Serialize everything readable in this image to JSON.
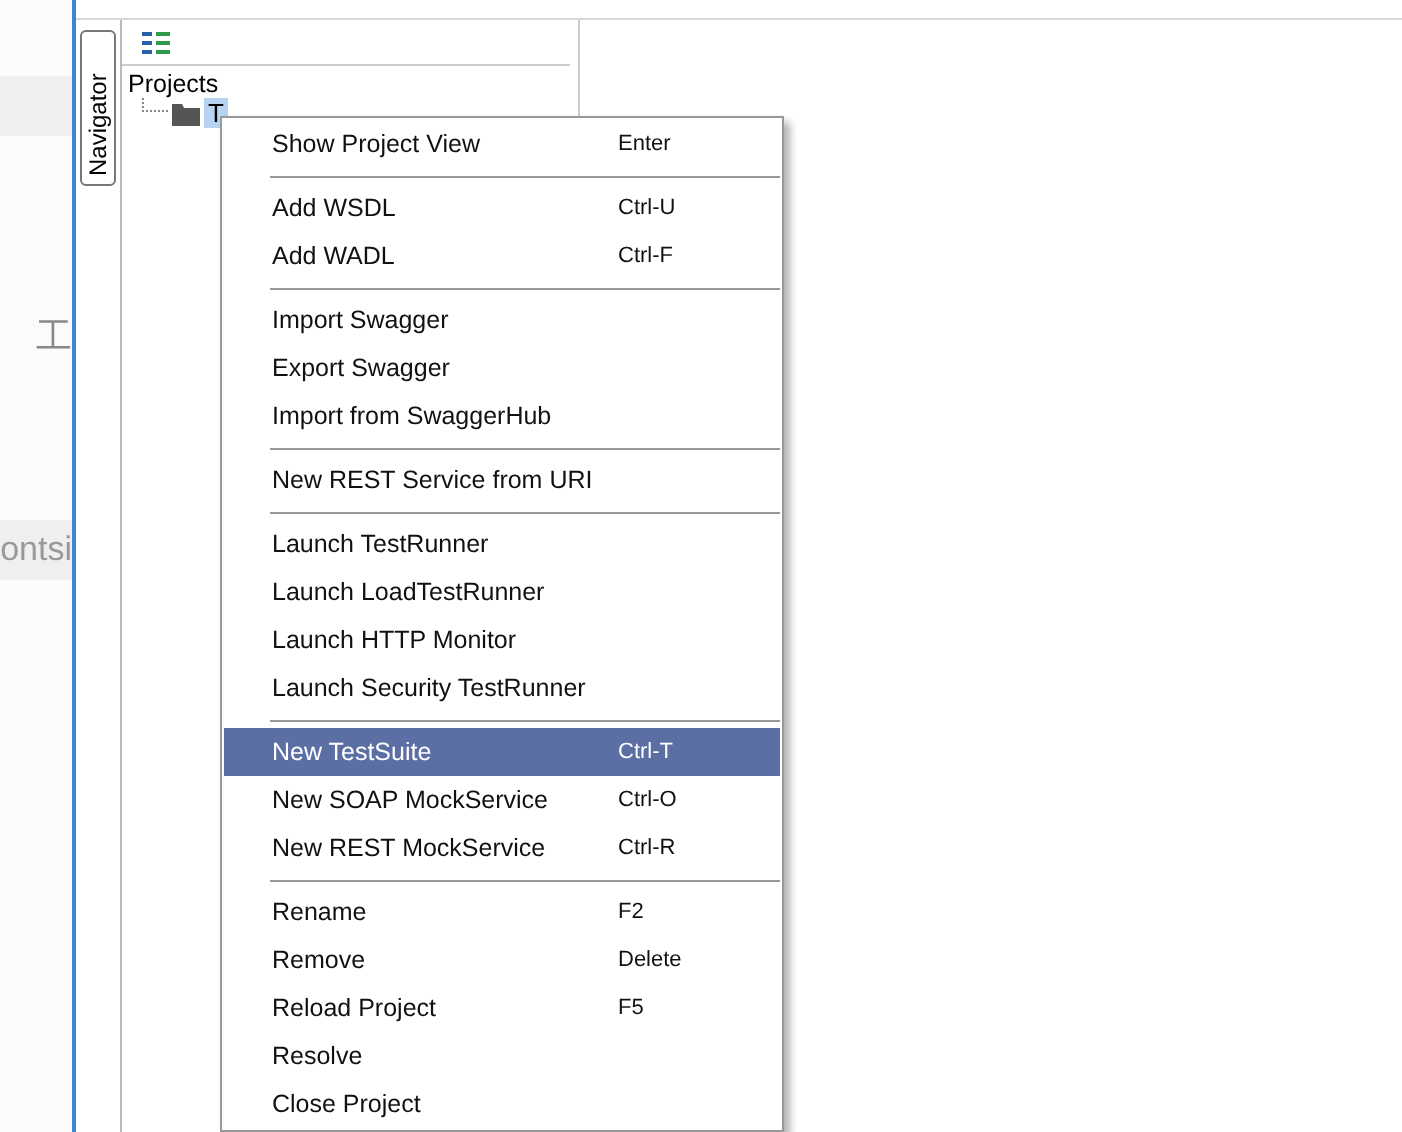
{
  "background_page": {
    "texts": [
      "工",
      "ontsi"
    ]
  },
  "navigator": {
    "tab_label": "Navigator",
    "tree_root": "Projects",
    "tree_items": [
      {
        "label": "T",
        "selected": true
      }
    ]
  },
  "context_menu": {
    "items": [
      {
        "kind": "item",
        "label": "Show Project View",
        "shortcut": "Enter",
        "selected": false
      },
      {
        "kind": "separator"
      },
      {
        "kind": "item",
        "label": "Add WSDL",
        "shortcut": "Ctrl-U",
        "selected": false
      },
      {
        "kind": "item",
        "label": "Add WADL",
        "shortcut": "Ctrl-F",
        "selected": false
      },
      {
        "kind": "separator"
      },
      {
        "kind": "item",
        "label": "Import Swagger",
        "selected": false
      },
      {
        "kind": "item",
        "label": "Export Swagger",
        "selected": false
      },
      {
        "kind": "item",
        "label": "Import from SwaggerHub",
        "selected": false
      },
      {
        "kind": "separator"
      },
      {
        "kind": "item",
        "label": "New REST Service from URI",
        "selected": false
      },
      {
        "kind": "separator"
      },
      {
        "kind": "item",
        "label": "Launch TestRunner",
        "selected": false
      },
      {
        "kind": "item",
        "label": "Launch LoadTestRunner",
        "selected": false
      },
      {
        "kind": "item",
        "label": "Launch HTTP Monitor",
        "selected": false
      },
      {
        "kind": "item",
        "label": "Launch Security TestRunner",
        "selected": false
      },
      {
        "kind": "separator"
      },
      {
        "kind": "item",
        "label": "New TestSuite",
        "shortcut": "Ctrl-T",
        "selected": true
      },
      {
        "kind": "item",
        "label": "New SOAP MockService",
        "shortcut": "Ctrl-O",
        "selected": false
      },
      {
        "kind": "item",
        "label": "New REST MockService",
        "shortcut": "Ctrl-R",
        "selected": false
      },
      {
        "kind": "separator"
      },
      {
        "kind": "item",
        "label": "Rename",
        "shortcut": "F2",
        "selected": false
      },
      {
        "kind": "item",
        "label": "Remove",
        "shortcut": "Delete",
        "selected": false
      },
      {
        "kind": "item",
        "label": "Reload Project",
        "shortcut": "F5",
        "selected": false
      },
      {
        "kind": "item",
        "label": "Resolve",
        "selected": false
      },
      {
        "kind": "item",
        "label": "Close Project",
        "selected": false
      }
    ]
  }
}
